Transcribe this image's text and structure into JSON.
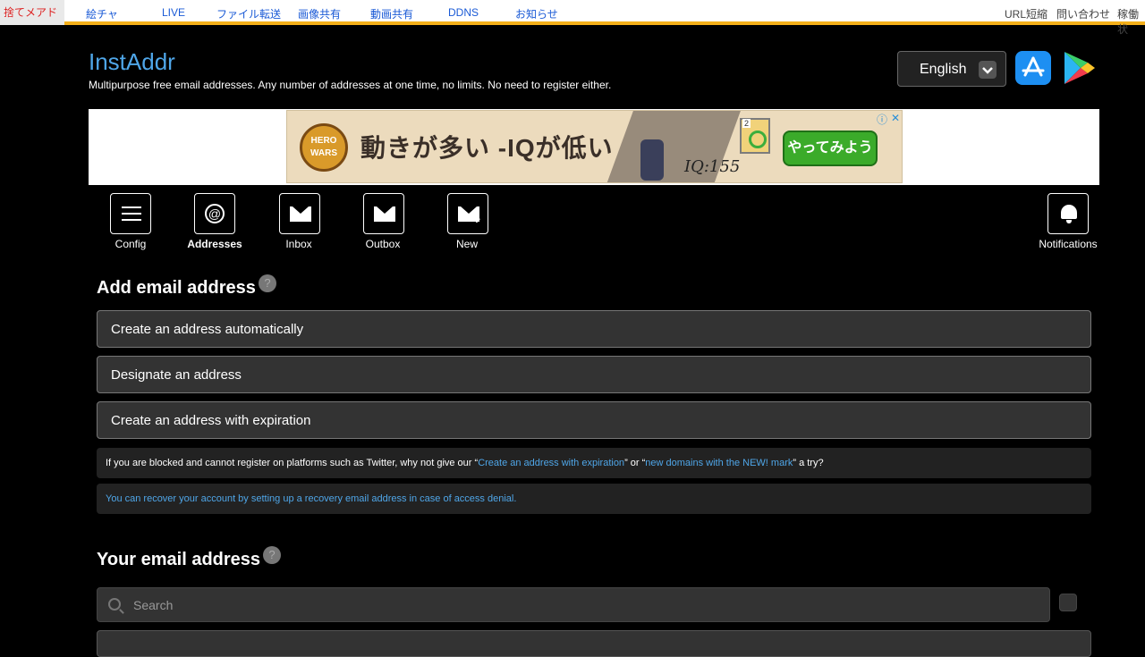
{
  "topnav": {
    "home": "捨てメアド",
    "links": [
      "絵チャ",
      "LIVE",
      "ファイル転送",
      "画像共有",
      "動画共有",
      "DDNS",
      "お知らせ"
    ],
    "right_links": [
      "URL短縮",
      "問い合わせ",
      "稼働状"
    ]
  },
  "brand": {
    "title": "InstAddr",
    "tagline": "Multipurpose free email addresses. Any number of addresses at one time, no limits. No need to register either."
  },
  "language": {
    "selected": "English"
  },
  "ad": {
    "logo_text": "HERO WARS",
    "headline": "動きが多い -IQが低い",
    "iq_text": "IQ:155",
    "card_number": "2",
    "cta": "やってみよう",
    "info": "ⓘ",
    "close": "✕"
  },
  "nav": {
    "config": "Config",
    "addresses": "Addresses",
    "inbox": "Inbox",
    "outbox": "Outbox",
    "new": "New",
    "notifications": "Notifications"
  },
  "add_section": {
    "title": "Add email address",
    "help": "?",
    "options": [
      "Create an address automatically",
      "Designate an address",
      "Create an address with expiration"
    ],
    "notice1": {
      "pre": "If you are blocked and cannot register on platforms such as Twitter, why not give our “",
      "link1": "Create an address with expiration",
      "mid": "” or “",
      "link2": "new domains with the NEW! mark",
      "post": "” a try?"
    },
    "notice2": "You can recover your account by setting up a recovery email address in case of access denial."
  },
  "your_section": {
    "title": "Your email address",
    "help": "?",
    "search_placeholder": "Search"
  }
}
